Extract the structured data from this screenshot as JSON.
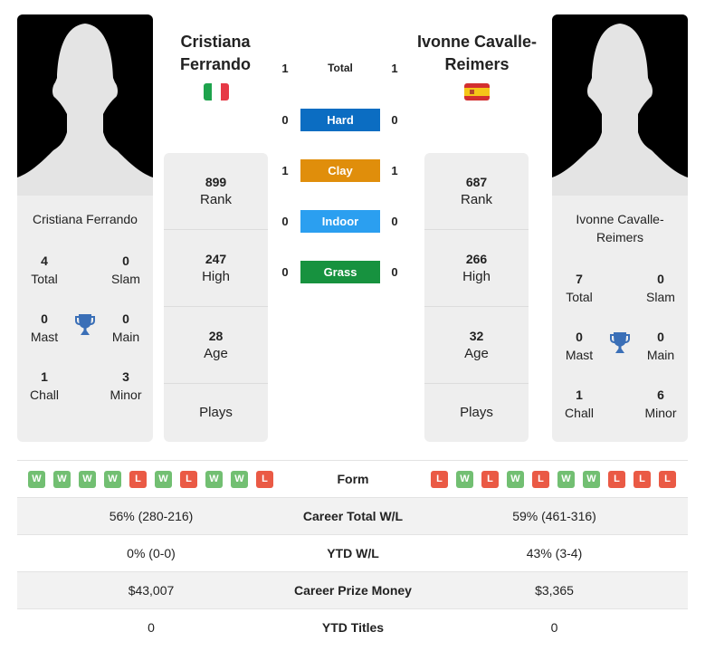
{
  "colors": {
    "hard": "#0b6dc2",
    "clay": "#e08e0b",
    "indoor": "#2b9ff0",
    "grass": "#17923f",
    "win": "#72bf72",
    "loss": "#ea5a45",
    "trophy": "#3a6fb7"
  },
  "player1": {
    "name": "Cristiana Ferrando",
    "name_line1": "Cristiana",
    "name_line2": "Ferrando",
    "flag": "italy-flag",
    "card_name": "Cristiana Ferrando",
    "titles": {
      "total": "4",
      "total_label": "Total",
      "slam": "0",
      "slam_label": "Slam",
      "mast": "0",
      "mast_label": "Mast",
      "main": "0",
      "main_label": "Main",
      "chall": "1",
      "chall_label": "Chall",
      "minor": "3",
      "minor_label": "Minor"
    },
    "stats": {
      "rank": "899",
      "rank_label": "Rank",
      "high": "247",
      "high_label": "High",
      "age": "28",
      "age_label": "Age",
      "plays_label": "Plays"
    },
    "form": [
      "W",
      "W",
      "W",
      "W",
      "L",
      "W",
      "L",
      "W",
      "W",
      "L"
    ],
    "career_wl": "56% (280-216)",
    "ytd_wl": "0% (0-0)",
    "prize_money": "$43,007",
    "ytd_titles": "0"
  },
  "player2": {
    "name": "Ivonne Cavalle-Reimers",
    "name_line1": "Ivonne Cavalle-",
    "name_line2": "Reimers",
    "flag": "spain-flag",
    "card_name_line1": "Ivonne Cavalle-",
    "card_name_line2": "Reimers",
    "titles": {
      "total": "7",
      "total_label": "Total",
      "slam": "0",
      "slam_label": "Slam",
      "mast": "0",
      "mast_label": "Mast",
      "main": "0",
      "main_label": "Main",
      "chall": "1",
      "chall_label": "Chall",
      "minor": "6",
      "minor_label": "Minor"
    },
    "stats": {
      "rank": "687",
      "rank_label": "Rank",
      "high": "266",
      "high_label": "High",
      "age": "32",
      "age_label": "Age",
      "plays_label": "Plays"
    },
    "form": [
      "L",
      "W",
      "L",
      "W",
      "L",
      "W",
      "W",
      "L",
      "L",
      "L"
    ],
    "career_wl": "59% (461-316)",
    "ytd_wl": "43% (3-4)",
    "prize_money": "$3,365",
    "ytd_titles": "0"
  },
  "h2h": [
    {
      "label": "Total",
      "p1": "1",
      "p2": "1"
    },
    {
      "label": "Hard",
      "p1": "0",
      "p2": "0"
    },
    {
      "label": "Clay",
      "p1": "1",
      "p2": "1"
    },
    {
      "label": "Indoor",
      "p1": "0",
      "p2": "0"
    },
    {
      "label": "Grass",
      "p1": "0",
      "p2": "0"
    }
  ],
  "table_labels": {
    "form": "Form",
    "career_wl": "Career Total W/L",
    "ytd_wl": "YTD W/L",
    "prize_money": "Career Prize Money",
    "ytd_titles": "YTD Titles"
  }
}
